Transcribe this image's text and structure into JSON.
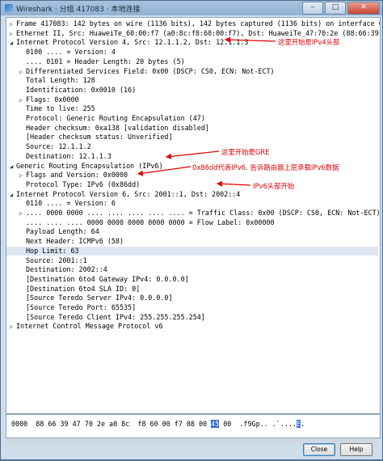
{
  "window": {
    "title": "Wireshark · 分组 417083 · 本地连接",
    "controls": [
      "–",
      "□",
      "✕"
    ]
  },
  "tree": [
    {
      "toggle": "▷",
      "indent": 0,
      "text": "Frame 417083: 142 bytes on wire (1136 bits), 142 bytes captured (1136 bits) on interface 0"
    },
    {
      "toggle": "▷",
      "indent": 0,
      "text": "Ethernet II, Src: HuaweiTe_60:00:f7 (a0:8c:f8:60:00:f7), Dst: HuaweiTe_47:70:2e (88:66:39:47:70:2e)"
    },
    {
      "toggle": "◢",
      "indent": 0,
      "text": "Internet Protocol Version 4, Src: 12.1.1.2, Dst: 12.1.1.3"
    },
    {
      "toggle": "",
      "indent": 1,
      "text": "0100 .... = Version: 4"
    },
    {
      "toggle": "",
      "indent": 1,
      "text": ".... 0101 = Header Length: 20 bytes (5)"
    },
    {
      "toggle": "▷",
      "indent": 1,
      "text": "Differentiated Services Field: 0x00 (DSCP: CS0, ECN: Not-ECT)"
    },
    {
      "toggle": "",
      "indent": 1,
      "text": "Total Length: 128"
    },
    {
      "toggle": "",
      "indent": 1,
      "text": "Identification: 0x0010 (16)"
    },
    {
      "toggle": "▷",
      "indent": 1,
      "text": "Flags: 0x0000"
    },
    {
      "toggle": "",
      "indent": 1,
      "text": "Time to live: 255"
    },
    {
      "toggle": "",
      "indent": 1,
      "text": "Protocol: Generic Routing Encapsulation (47)"
    },
    {
      "toggle": "",
      "indent": 1,
      "text": "Header checksum: 0xa138 [validation disabled]"
    },
    {
      "toggle": "",
      "indent": 1,
      "text": "[Header checksum status: Unverified]"
    },
    {
      "toggle": "",
      "indent": 1,
      "text": "Source: 12.1.1.2"
    },
    {
      "toggle": "",
      "indent": 1,
      "text": "Destination: 12.1.1.3"
    },
    {
      "toggle": "◢",
      "indent": 0,
      "text": "Generic Routing Encapsulation (IPv6)"
    },
    {
      "toggle": "▷",
      "indent": 1,
      "text": "Flags and Version: 0x0000"
    },
    {
      "toggle": "",
      "indent": 1,
      "text": "Protocol Type: IPv6 (0x86dd)"
    },
    {
      "toggle": "◢",
      "indent": 0,
      "text": "Internet Protocol Version 6, Src: 2001::1, Dst: 2002::4"
    },
    {
      "toggle": "",
      "indent": 1,
      "text": "0110 .... = Version: 6"
    },
    {
      "toggle": "▷",
      "indent": 1,
      "text": ".... 0000 0000 .... .... .... .... .... = Traffic Class: 0x00 (DSCP: CS0, ECN: Not-ECT)"
    },
    {
      "toggle": "",
      "indent": 1,
      "text": ".... .... .... 0000 0000 0000 0000 0000 = Flow Label: 0x00000"
    },
    {
      "toggle": "",
      "indent": 1,
      "text": "Payload Length: 64"
    },
    {
      "toggle": "",
      "indent": 1,
      "text": "Next Header: ICMPv6 (58)"
    },
    {
      "toggle": "",
      "indent": 1,
      "text": "Hop Limit: 63",
      "selected": true
    },
    {
      "toggle": "",
      "indent": 1,
      "text": "Source: 2001::1"
    },
    {
      "toggle": "",
      "indent": 1,
      "text": "Destination: 2002::4"
    },
    {
      "toggle": "",
      "indent": 1,
      "text": "[Destination 6to4 Gateway IPv4: 0.0.0.0]"
    },
    {
      "toggle": "",
      "indent": 1,
      "text": "[Destination 6to4 SLA ID: 0]"
    },
    {
      "toggle": "",
      "indent": 1,
      "text": "[Source Teredo Server IPv4: 0.0.0.0]"
    },
    {
      "toggle": "",
      "indent": 1,
      "text": "[Source Teredo Port: 65535]"
    },
    {
      "toggle": "",
      "indent": 1,
      "text": "[Source Teredo Client IPv4: 255.255.255.254]"
    },
    {
      "toggle": "▷",
      "indent": 0,
      "text": "Internet Control Message Protocol v6"
    }
  ],
  "annotations": [
    {
      "text": "这里开始是IPv4头部"
    },
    {
      "text": "这里开始是GRE"
    },
    {
      "text": "0x86dd代表IPv6. 告诉路由器上层承载IPv6数据"
    },
    {
      "text": "IPv6头部开始"
    }
  ],
  "hex": {
    "offset": "0000",
    "bytes_before": "88 66 39 47 70 2e a0 8c  f8 60 00 f7 08 00 ",
    "highlight": "45",
    "bytes_after": " 00",
    "ascii_before": "  .f9Gp.. .`....",
    "ascii_highlight": "E",
    "ascii_after": "."
  },
  "buttons": {
    "close": "Close",
    "help": "Help"
  },
  "accent_color": "#e00000"
}
